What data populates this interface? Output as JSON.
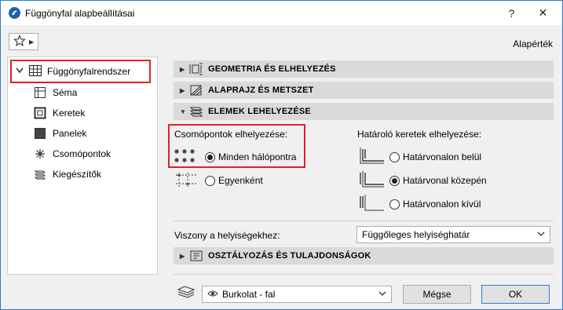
{
  "window": {
    "title": "Függönyfal alapbeállításai",
    "help_label": "?",
    "close_label": "✕"
  },
  "toolbar": {
    "defaults_label": "Alapérték"
  },
  "sidebar": {
    "root_label": "Függönyfalrendszer",
    "items": [
      {
        "label": "Séma"
      },
      {
        "label": "Keretek"
      },
      {
        "label": "Panelek"
      },
      {
        "label": "Csomópontok"
      },
      {
        "label": "Kiegészítők"
      }
    ]
  },
  "sections": {
    "geometry": "GEOMETRIA ÉS ELHELYEZÉS",
    "plan": "ALAPRAJZ ÉS METSZET",
    "placement": "ELEMEK LEHELYEZÉSE",
    "classification": "OSZTÁLYOZÁS ÉS TULAJDONSÁGOK"
  },
  "junctions": {
    "label": "Csomópontok elhelyezése:",
    "options": [
      {
        "label": "Minden hálópontra",
        "selected": true
      },
      {
        "label": "Egyenként",
        "selected": false
      }
    ]
  },
  "boundary": {
    "label": "Határoló keretek elhelyezése:",
    "options": [
      {
        "label": "Határvonalon belül",
        "selected": false
      },
      {
        "label": "Határvonal közepén",
        "selected": true
      },
      {
        "label": "Határvonalon kívül",
        "selected": false
      }
    ]
  },
  "zone_relation": {
    "label": "Viszony a helyiségekhez:",
    "value": "Függőleges helyiséghatár"
  },
  "footer": {
    "layer_value": "Burkolat - fal",
    "cancel_label": "Mégse",
    "ok_label": "OK"
  },
  "colors": {
    "accent": "#2b7bd6",
    "highlight": "#e0202a",
    "section_bg": "#dadada"
  }
}
